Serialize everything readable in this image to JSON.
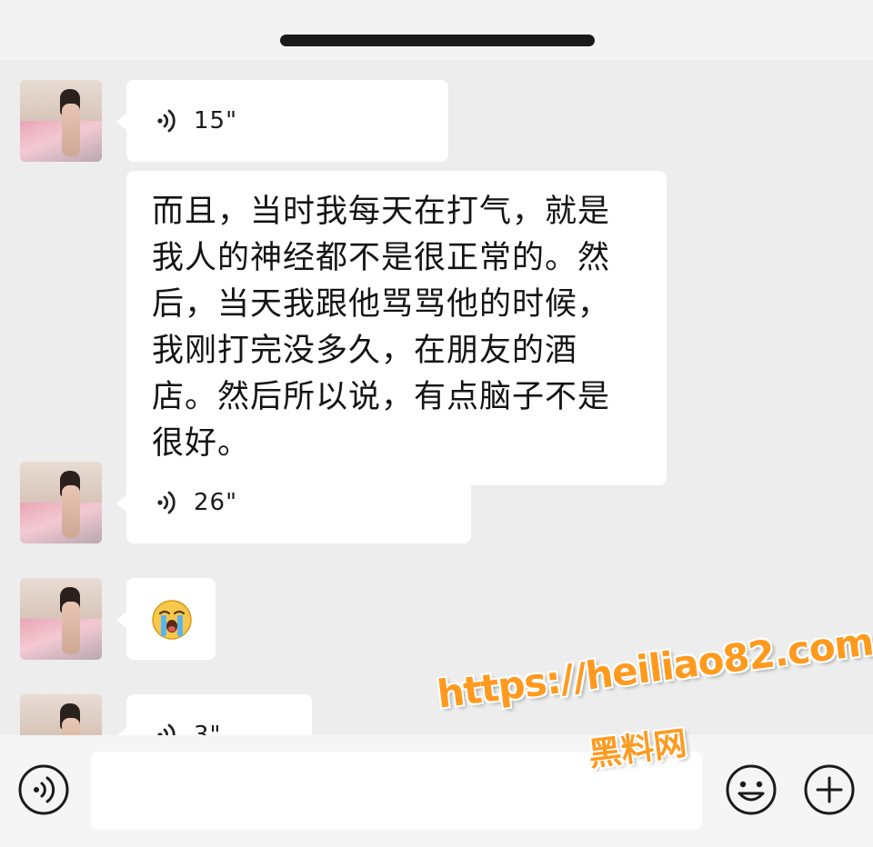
{
  "messages": [
    {
      "type": "voice",
      "duration": "15\""
    },
    {
      "type": "text",
      "text": "而且，当时我每天在打气，就是我人的神经都不是很正常的。然后，当天我跟他骂骂他的时候，我刚打完没多久，在朋友的酒店。然后所以说，有点脑子不是很好。"
    },
    {
      "type": "voice",
      "duration": "26\""
    },
    {
      "type": "emoji",
      "emoji_name": "loudly-crying-face"
    },
    {
      "type": "voice",
      "duration": "3\""
    }
  ],
  "input_bar": {
    "left_icon": "voice-mode-icon",
    "emoji_icon": "smiley-icon",
    "plus_icon": "plus-circle-icon",
    "input_value": ""
  },
  "watermark": {
    "url": "https://heiliao82.com",
    "cn": "黑料网",
    "color": "#ff9a1f"
  },
  "colors": {
    "background": "#ededed",
    "bubble": "#ffffff",
    "text": "#141414"
  }
}
